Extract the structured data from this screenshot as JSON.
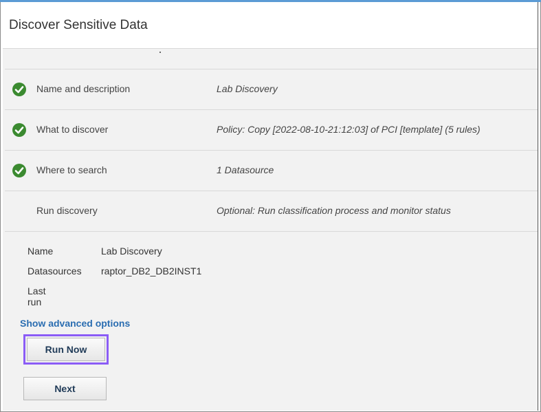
{
  "header": {
    "title": "Discover Sensitive Data"
  },
  "steps": [
    {
      "label": "Name and description",
      "value": "Lab Discovery",
      "complete": true
    },
    {
      "label": "What to discover",
      "value": "Policy: Copy [2022-08-10-21:12:03] of PCI [template] (5 rules)",
      "complete": true
    },
    {
      "label": "Where to search",
      "value": "1 Datasource",
      "complete": true
    },
    {
      "label": "Run discovery",
      "value": "Optional: Run classification process and monitor status",
      "complete": false
    }
  ],
  "details": [
    {
      "key": "Name",
      "value": "Lab Discovery"
    },
    {
      "key": "Datasources",
      "value": "raptor_DB2_DB2INST1"
    },
    {
      "key": "Last run",
      "value": ""
    }
  ],
  "links": {
    "advanced": "Show advanced options"
  },
  "buttons": {
    "run_now": "Run Now",
    "next": "Next"
  },
  "colors": {
    "check": "#3b8a30",
    "link": "#2a6db1",
    "highlight": "#8b5cf6"
  },
  "icons": {
    "step_complete": "checkmark-circle-icon"
  }
}
